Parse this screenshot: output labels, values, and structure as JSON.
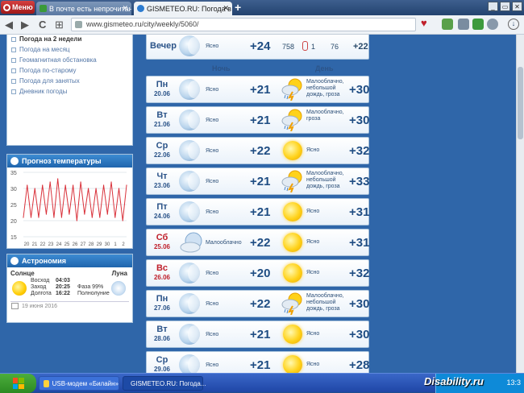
{
  "browser": {
    "menu_label": "Меню",
    "tabs": [
      {
        "label": "В почте есть непрочитанн"
      },
      {
        "label": "GISMETEO.RU: Погода в Во"
      }
    ],
    "url": "www.gismeteo.ru/city/weekly/5060/",
    "new_tab": "+",
    "nav": {
      "back": "◀",
      "forward": "▶",
      "reload": "C",
      "apps": "⊞"
    }
  },
  "sidebar": {
    "links": [
      {
        "label": "Погода на 2 недели",
        "current": true
      },
      {
        "label": "Погода на месяц"
      },
      {
        "label": "Геомагнитная обстановка"
      },
      {
        "label": "Погода по-старому"
      },
      {
        "label": "Погода для занятых"
      },
      {
        "label": "Дневник погоды"
      }
    ],
    "temp_forecast": {
      "title": "Прогноз температуры"
    },
    "astronomy": {
      "title": "Астрономия",
      "sun_label": "Солнце",
      "moon_label": "Луна",
      "sunrise_label": "Восход",
      "sunrise": "04:03",
      "sunset_label": "Заход",
      "sunset": "20:25",
      "daylength_label": "Долгота",
      "daylength": "16:22",
      "phase_label": "Фаза 99%",
      "phase_name": "Полнолуние",
      "date": "19 июня 2016"
    }
  },
  "chart_data": {
    "type": "line",
    "title": "Прогноз температуры",
    "y_ticks": [
      "35",
      "30",
      "25",
      "20",
      "15"
    ],
    "ylim": [
      15,
      35
    ],
    "x_ticks": [
      "20",
      "21",
      "22",
      "23",
      "24",
      "25",
      "26",
      "27",
      "28",
      "29",
      "30",
      "1",
      "2"
    ],
    "series": [
      {
        "values": [
          21,
          31,
          21,
          30,
          21,
          31,
          22,
          32,
          21,
          33,
          21,
          31,
          22,
          31,
          20,
          32,
          22,
          30,
          21,
          30,
          21,
          31,
          22,
          32,
          21,
          30,
          20,
          31
        ]
      }
    ]
  },
  "forecast": {
    "evening": {
      "label": "Вечер",
      "cond": "Ясно",
      "temp": "+24",
      "pressure": "758",
      "wind": "1",
      "humidity": "76",
      "feels": "+22"
    },
    "col_night": "Ночь",
    "col_day": "День",
    "days": [
      {
        "dow": "Пн",
        "date": "20.06",
        "red": false,
        "night_cond": "Ясно",
        "night_temp": "+21",
        "day_icon": "storm",
        "day_cond": "Малооблачно, небольшой дождь, гроза",
        "day_temp": "+30"
      },
      {
        "dow": "Вт",
        "date": "21.06",
        "red": false,
        "night_cond": "Ясно",
        "night_temp": "+21",
        "day_icon": "storm",
        "day_cond": "Малооблачно, гроза",
        "day_temp": "+30"
      },
      {
        "dow": "Ср",
        "date": "22.06",
        "red": false,
        "night_cond": "Ясно",
        "night_temp": "+22",
        "day_icon": "sun",
        "day_cond": "Ясно",
        "day_temp": "+32"
      },
      {
        "dow": "Чт",
        "date": "23.06",
        "red": false,
        "night_cond": "Ясно",
        "night_temp": "+21",
        "day_icon": "storm",
        "day_cond": "Малооблачно, небольшой дождь, гроза",
        "day_temp": "+33"
      },
      {
        "dow": "Пт",
        "date": "24.06",
        "red": false,
        "night_cond": "Ясно",
        "night_temp": "+21",
        "day_icon": "sun",
        "day_cond": "Ясно",
        "day_temp": "+31"
      },
      {
        "dow": "Сб",
        "date": "25.06",
        "red": true,
        "night_icon": "cloud",
        "night_cond": "Малооблачно",
        "night_temp": "+22",
        "day_icon": "sun",
        "day_cond": "Ясно",
        "day_temp": "+31"
      },
      {
        "dow": "Вс",
        "date": "26.06",
        "red": true,
        "night_cond": "Ясно",
        "night_temp": "+20",
        "day_icon": "sun",
        "day_cond": "Ясно",
        "day_temp": "+32"
      },
      {
        "dow": "Пн",
        "date": "27.06",
        "red": false,
        "night_cond": "Ясно",
        "night_temp": "+22",
        "day_icon": "storm",
        "day_cond": "Малооблачно, небольшой дождь, гроза",
        "day_temp": "+30"
      },
      {
        "dow": "Вт",
        "date": "28.06",
        "red": false,
        "night_cond": "Ясно",
        "night_temp": "+21",
        "day_icon": "sun",
        "day_cond": "Ясно",
        "day_temp": "+30"
      },
      {
        "dow": "Ср",
        "date": "29.06",
        "red": false,
        "night_cond": "Ясно",
        "night_temp": "+21",
        "day_icon": "sun",
        "day_cond": "Ясно",
        "day_temp": "+28"
      }
    ]
  },
  "taskbar": {
    "tasks": [
      {
        "label": "USB-модем «Билайн»"
      },
      {
        "label": "GISMETEO.RU: Погода..."
      }
    ],
    "clock": "13:3",
    "watermark": "Disability.ru"
  }
}
